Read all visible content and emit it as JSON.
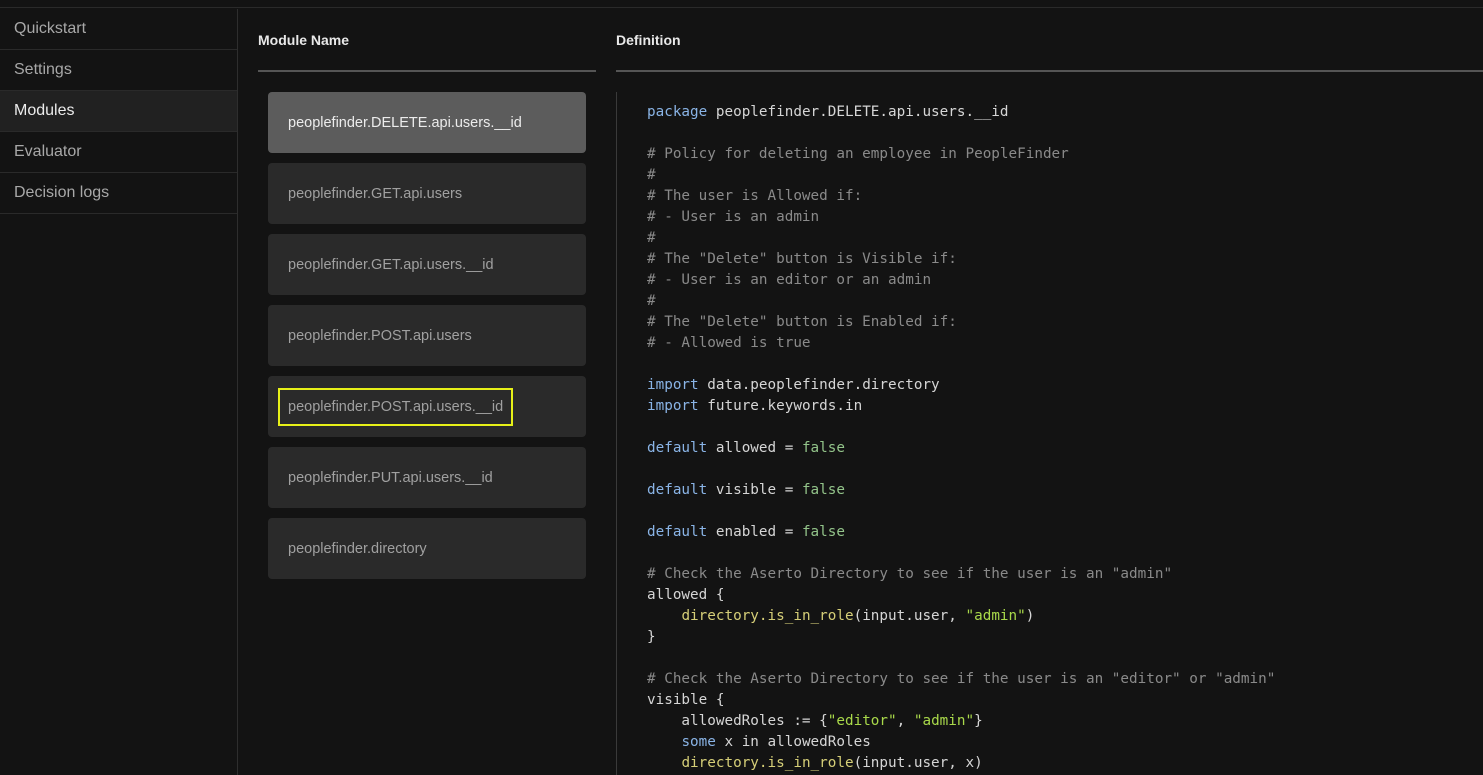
{
  "sidebar": {
    "items": [
      {
        "label": "Quickstart",
        "active": false
      },
      {
        "label": "Settings",
        "active": false
      },
      {
        "label": "Modules",
        "active": true
      },
      {
        "label": "Evaluator",
        "active": false
      },
      {
        "label": "Decision logs",
        "active": false
      }
    ]
  },
  "columns": {
    "module_name": "Module Name",
    "definition": "Definition"
  },
  "modules": [
    {
      "label": "peoplefinder.DELETE.api.users.__id",
      "selected": true,
      "focused": false
    },
    {
      "label": "peoplefinder.GET.api.users",
      "selected": false,
      "focused": false
    },
    {
      "label": "peoplefinder.GET.api.users.__id",
      "selected": false,
      "focused": false
    },
    {
      "label": "peoplefinder.POST.api.users",
      "selected": false,
      "focused": false
    },
    {
      "label": "peoplefinder.POST.api.users.__id",
      "selected": false,
      "focused": true
    },
    {
      "label": "peoplefinder.PUT.api.users.__id",
      "selected": false,
      "focused": false
    },
    {
      "label": "peoplefinder.directory",
      "selected": false,
      "focused": false
    }
  ],
  "colors": {
    "keyword": "#8ab4e6",
    "comment": "#8a8a8a",
    "boolean": "#93c48a",
    "function": "#d6cf78",
    "string": "#a9d94a",
    "focus_outline": "#e6f018"
  },
  "code": [
    [
      [
        "kw",
        "package"
      ],
      [
        "plain",
        " peoplefinder.DELETE.api.users.__id"
      ]
    ],
    [],
    [
      [
        "comment",
        "# Policy for deleting an employee in PeopleFinder"
      ]
    ],
    [
      [
        "comment",
        "#"
      ]
    ],
    [
      [
        "comment",
        "# The user is Allowed if:"
      ]
    ],
    [
      [
        "comment",
        "# - User is an admin"
      ]
    ],
    [
      [
        "comment",
        "#"
      ]
    ],
    [
      [
        "comment",
        "# The \"Delete\" button is Visible if:"
      ]
    ],
    [
      [
        "comment",
        "# - User is an editor or an admin"
      ]
    ],
    [
      [
        "comment",
        "#"
      ]
    ],
    [
      [
        "comment",
        "# The \"Delete\" button is Enabled if:"
      ]
    ],
    [
      [
        "comment",
        "# - Allowed is true"
      ]
    ],
    [],
    [
      [
        "kw",
        "import"
      ],
      [
        "plain",
        " data.peoplefinder.directory"
      ]
    ],
    [
      [
        "kw",
        "import"
      ],
      [
        "plain",
        " future.keywords.in"
      ]
    ],
    [],
    [
      [
        "kw",
        "default"
      ],
      [
        "plain",
        " allowed = "
      ],
      [
        "bool",
        "false"
      ]
    ],
    [],
    [
      [
        "kw",
        "default"
      ],
      [
        "plain",
        " visible = "
      ],
      [
        "bool",
        "false"
      ]
    ],
    [],
    [
      [
        "kw",
        "default"
      ],
      [
        "plain",
        " enabled = "
      ],
      [
        "bool",
        "false"
      ]
    ],
    [],
    [
      [
        "comment",
        "# Check the Aserto Directory to see if the user is an \"admin\""
      ]
    ],
    [
      [
        "plain",
        "allowed {"
      ]
    ],
    [
      [
        "plain",
        "    "
      ],
      [
        "fn",
        "directory.is_in_role"
      ],
      [
        "plain",
        "(input.user, "
      ],
      [
        "str",
        "\"admin\""
      ],
      [
        "plain",
        ")"
      ]
    ],
    [
      [
        "plain",
        "}"
      ]
    ],
    [],
    [
      [
        "comment",
        "# Check the Aserto Directory to see if the user is an \"editor\" or \"admin\""
      ]
    ],
    [
      [
        "plain",
        "visible {"
      ]
    ],
    [
      [
        "plain",
        "    allowedRoles := {"
      ],
      [
        "str",
        "\"editor\""
      ],
      [
        "plain",
        ", "
      ],
      [
        "str",
        "\"admin\""
      ],
      [
        "plain",
        "}"
      ]
    ],
    [
      [
        "plain",
        "    "
      ],
      [
        "kw",
        "some"
      ],
      [
        "plain",
        " x in allowedRoles"
      ]
    ],
    [
      [
        "plain",
        "    "
      ],
      [
        "fn",
        "directory.is_in_role"
      ],
      [
        "plain",
        "(input.user, x)"
      ]
    ]
  ]
}
